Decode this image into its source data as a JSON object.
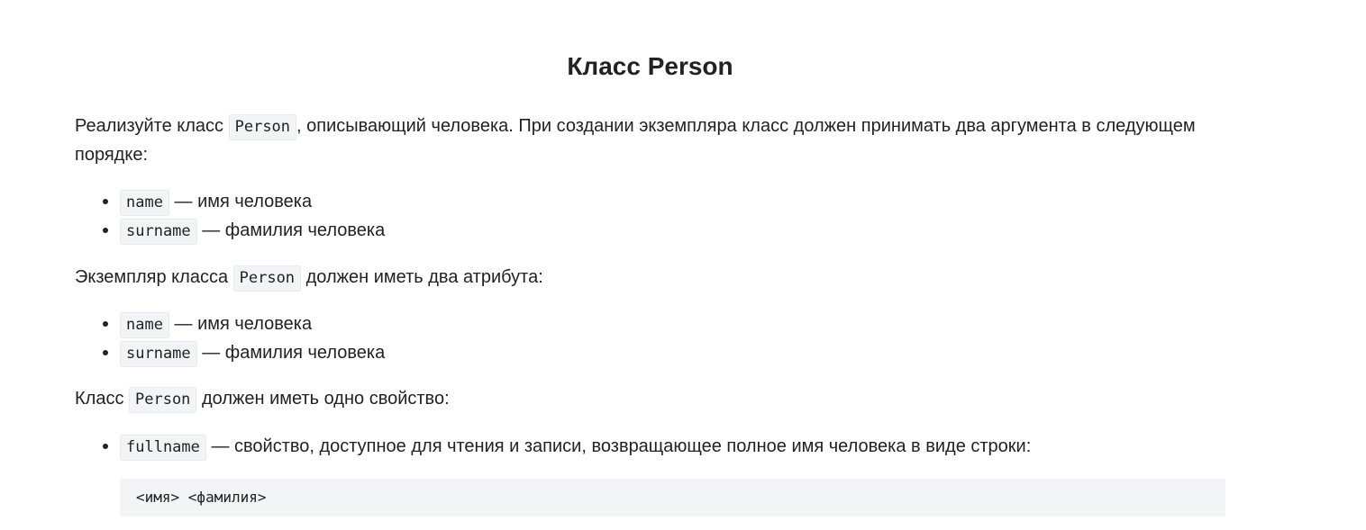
{
  "title": "Класс Person",
  "intro": {
    "before": "Реализуйте класс ",
    "code": "Person",
    "after": ", описывающий человека. При создании экземпляра класс должен принимать два аргумента в следующем порядке:"
  },
  "args_list": [
    {
      "code": "name",
      "text": " — имя человека"
    },
    {
      "code": "surname",
      "text": " — фамилия человека"
    }
  ],
  "attrs_intro": {
    "before": "Экземпляр класса ",
    "code": "Person",
    "after": " должен иметь два атрибута:"
  },
  "attrs_list": [
    {
      "code": "name",
      "text": " — имя человека"
    },
    {
      "code": "surname",
      "text": " — фамилия человека"
    }
  ],
  "prop_intro": {
    "before": "Класс ",
    "code": "Person",
    "after": " должен иметь одно свойство:"
  },
  "prop_list": [
    {
      "code": "fullname",
      "text": " — свойство, доступное для чтения и записи, возвращающее полное имя человека в виде строки:"
    }
  ],
  "code_block": "<имя> <фамилия>"
}
